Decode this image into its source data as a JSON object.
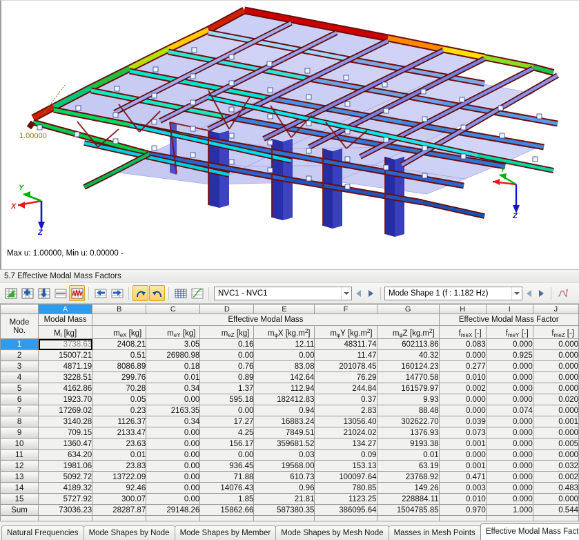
{
  "viewport": {
    "status_text": "Max u: 1.00000, Min u: 0.00000 -",
    "scale_label": "1.00000",
    "axis_x": "X",
    "axis_y": "Y",
    "axis_z": "Z",
    "axis_z_small": "Z",
    "axis_y_small": "Y",
    "colors": {
      "axis_x": "#e11b1b",
      "axis_y": "#00b000",
      "axis_z": "#1414c8",
      "scale_label": "#8a7a14"
    }
  },
  "panel": {
    "title": "5.7 Effective Modal Mass Factors"
  },
  "toolbar": {
    "buttons": [
      {
        "name": "show-results-diagram-icon",
        "label": "Results Diagram",
        "active": false
      },
      {
        "name": "insert-row-icon",
        "label": "Insert Row",
        "active": false
      },
      {
        "name": "import-icon",
        "label": "Import Data",
        "active": false
      },
      {
        "name": "table-filter-icon",
        "label": "Table Filter",
        "active": false
      },
      {
        "name": "result-graph-icon",
        "label": "Result Graph",
        "active": true
      },
      {
        "name": "arrow-left-table-icon",
        "label": "Previous Table",
        "active": false
      },
      {
        "name": "arrow-right-table-icon",
        "label": "Next Table",
        "active": false
      },
      {
        "name": "sync-selection-icon",
        "label": "Synchronize Selection",
        "active": true
      },
      {
        "name": "sync-view-icon",
        "label": "Synchronize View",
        "active": true
      },
      {
        "name": "table-settings-icon",
        "label": "Table Settings",
        "active": false
      },
      {
        "name": "export-chart-icon",
        "label": "Export Chart",
        "active": false
      }
    ],
    "load_case_combo": {
      "value": "NVC1 - NVC1",
      "placeholder": "NVC1 - NVC1"
    },
    "mode_combo": {
      "value": "Mode Shape 1 (f : 1.182 Hz)",
      "placeholder": "Mode Shape 1 (f : 1.182 Hz)"
    },
    "trailing_icon": {
      "name": "curve-function-icon",
      "label": "Function Curve"
    }
  },
  "table": {
    "column_letters": [
      "",
      "A",
      "B",
      "C",
      "D",
      "E",
      "F",
      "G",
      "H",
      "I",
      "J"
    ],
    "selected_letter": "A",
    "row_header_title_line1": "Mode",
    "row_header_title_line2": "No.",
    "group_headers": [
      {
        "label": "",
        "span": 1
      },
      {
        "label": "Modal Mass",
        "span": 1
      },
      {
        "label": "Effective Modal Mass",
        "span": 6
      },
      {
        "label": "Effective Modal Mass Factor",
        "span": 3
      }
    ],
    "unit_headers": [
      "",
      "Mᵢ [kg]",
      "mₑX [kg]",
      "mₑY [kg]",
      "mₑZ [kg]",
      "mφX [kg.m²]",
      "mφY [kg.m²]",
      "mφZ [kg.m²]",
      "fₘₑX [-]",
      "fₘₑY [-]",
      "fₘₑZ [-]"
    ],
    "selected_row": 1,
    "selected_cell_row": 1,
    "selected_cell_col": 1,
    "rows": [
      {
        "no": "1",
        "cells": [
          "3738.63",
          "2408.21",
          "3.05",
          "0.16",
          "12.11",
          "48311.74",
          "602113.86",
          "0.083",
          "0.000",
          "0.000"
        ]
      },
      {
        "no": "2",
        "cells": [
          "15007.21",
          "0.51",
          "26980.98",
          "0.00",
          "0.00",
          "11.47",
          "40.32",
          "0.000",
          "0.925",
          "0.000"
        ]
      },
      {
        "no": "3",
        "cells": [
          "4871.19",
          "8086.89",
          "0.18",
          "0.76",
          "83.08",
          "201078.45",
          "160124.23",
          "0.277",
          "0.000",
          "0.000"
        ]
      },
      {
        "no": "4",
        "cells": [
          "3228.51",
          "299.76",
          "0.01",
          "0.89",
          "142.64",
          "76.29",
          "14770.58",
          "0.010",
          "0.000",
          "0.000"
        ]
      },
      {
        "no": "5",
        "cells": [
          "4162.86",
          "70.28",
          "0.34",
          "1.37",
          "112.94",
          "244.84",
          "161579.97",
          "0.002",
          "0.000",
          "0.000"
        ]
      },
      {
        "no": "6",
        "cells": [
          "1923.70",
          "0.05",
          "0.00",
          "595.18",
          "182412.83",
          "0.37",
          "9.93",
          "0.000",
          "0.000",
          "0.020"
        ]
      },
      {
        "no": "7",
        "cells": [
          "17269.02",
          "0.23",
          "2163.35",
          "0.00",
          "0.94",
          "2.83",
          "88.48",
          "0.000",
          "0.074",
          "0.000"
        ]
      },
      {
        "no": "8",
        "cells": [
          "3140.28",
          "1126.37",
          "0.34",
          "17.27",
          "16883.24",
          "13056.40",
          "302622.70",
          "0.039",
          "0.000",
          "0.001"
        ]
      },
      {
        "no": "9",
        "cells": [
          "709.15",
          "2133.47",
          "0.00",
          "4.25",
          "7849.51",
          "21024.02",
          "1376.93",
          "0.073",
          "0.000",
          "0.000"
        ]
      },
      {
        "no": "10",
        "cells": [
          "1360.47",
          "23.63",
          "0.00",
          "156.17",
          "359681.52",
          "134.27",
          "9193.38",
          "0.001",
          "0.000",
          "0.005"
        ]
      },
      {
        "no": "11",
        "cells": [
          "634.20",
          "0.01",
          "0.00",
          "0.00",
          "0.03",
          "0.09",
          "0.01",
          "0.000",
          "0.000",
          "0.000"
        ]
      },
      {
        "no": "12",
        "cells": [
          "1981.06",
          "23.83",
          "0.00",
          "936.45",
          "19568.00",
          "153.13",
          "63.19",
          "0.001",
          "0.000",
          "0.032"
        ]
      },
      {
        "no": "13",
        "cells": [
          "5092.72",
          "13722.09",
          "0.00",
          "71.88",
          "610.73",
          "100097.64",
          "23768.92",
          "0.471",
          "0.000",
          "0.002"
        ]
      },
      {
        "no": "14",
        "cells": [
          "4189.32",
          "92.46",
          "0.00",
          "14076.43",
          "0.96",
          "780.85",
          "149.26",
          "0.003",
          "0.000",
          "0.483"
        ]
      },
      {
        "no": "15",
        "cells": [
          "5727.92",
          "300.07",
          "0.00",
          "1.85",
          "21.81",
          "1123.25",
          "228884.11",
          "0.010",
          "0.000",
          "0.000"
        ]
      }
    ],
    "sum_row": {
      "no": "Sum",
      "cells": [
        "73036.23",
        "28287.87",
        "29148.26",
        "15862.66",
        "587380.35",
        "386095.64",
        "1504785.85",
        "0.970",
        "1.000",
        "0.544"
      ]
    }
  },
  "tabs": {
    "items": [
      {
        "label": "Natural Frequencies",
        "active": false
      },
      {
        "label": "Mode Shapes by Node",
        "active": false
      },
      {
        "label": "Mode Shapes by Member",
        "active": false
      },
      {
        "label": "Mode Shapes by Mesh Node",
        "active": false
      },
      {
        "label": "Masses in Mesh Points",
        "active": false
      },
      {
        "label": "Effective Modal Mass Factors",
        "active": true
      }
    ]
  }
}
